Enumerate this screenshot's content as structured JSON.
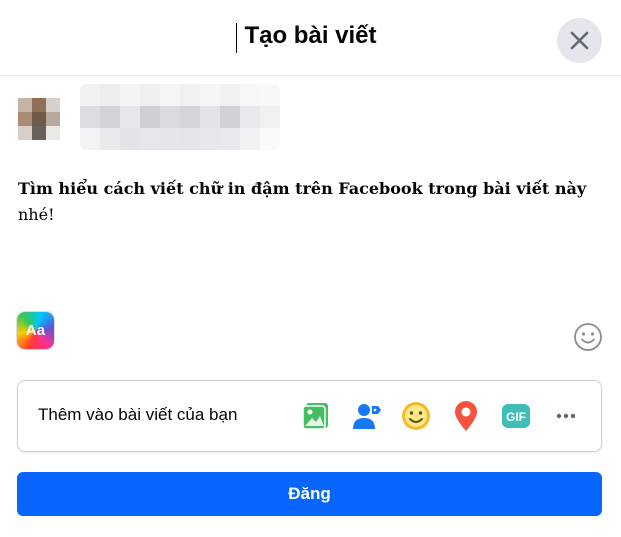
{
  "dialog": {
    "title": "Tạo bài viết"
  },
  "post": {
    "text_bold": "Tìm hiểu cách viết chữ in đậm trên Facebook trong bài viết này",
    "text_regular": "nhé!"
  },
  "composer": {
    "text_format_label": "Aa"
  },
  "add_to_post": {
    "label": "Thêm vào bài viết của bạn",
    "icons": [
      "photo-video-icon",
      "tag-people-icon",
      "feeling-icon",
      "check-in-icon",
      "gif-icon",
      "more-icon"
    ]
  },
  "actions": {
    "post_label": "Đăng"
  },
  "colors": {
    "primary": "#0866ff",
    "photo": "#45bd62",
    "tag": "#1877f2",
    "feeling": "#f7b928",
    "checkin": "#f5533d",
    "gif": "#3fbdb6"
  }
}
